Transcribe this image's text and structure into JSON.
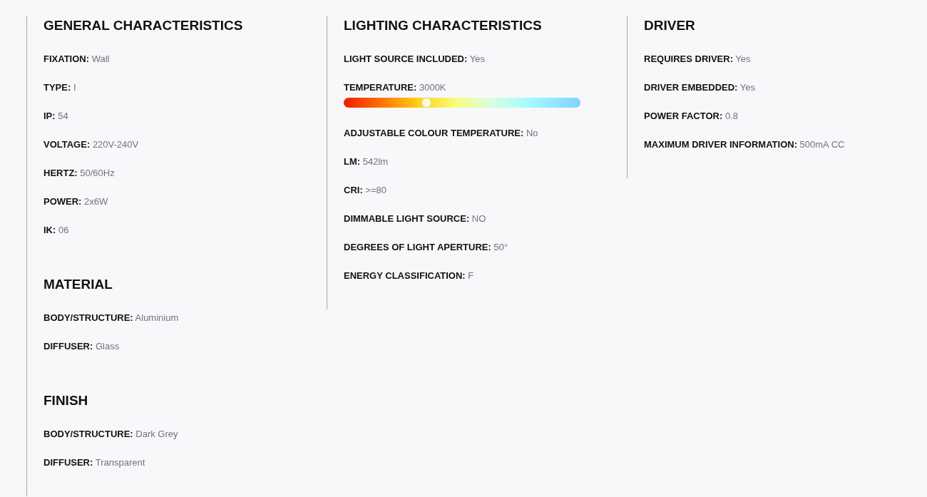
{
  "columns": [
    {
      "sections": [
        {
          "title": "GENERAL CHARACTERISTICS",
          "items": [
            {
              "kind": "text",
              "label": "FIXATION:",
              "value": "Wall"
            },
            {
              "kind": "text",
              "label": "TYPE:",
              "value": "I"
            },
            {
              "kind": "text",
              "label": "IP:",
              "value": "54"
            },
            {
              "kind": "text",
              "label": "VOLTAGE:",
              "value": "220V-240V"
            },
            {
              "kind": "text",
              "label": "HERTZ:",
              "value": "50/60Hz"
            },
            {
              "kind": "text",
              "label": "POWER:",
              "value": "2x6W"
            },
            {
              "kind": "text",
              "label": "IK:",
              "value": "06"
            }
          ]
        },
        {
          "title": "MATERIAL",
          "items": [
            {
              "kind": "text",
              "label": "BODY/STRUCTURE:",
              "value": "Aluminium"
            },
            {
              "kind": "text",
              "label": "DIFFUSER:",
              "value": "Glass"
            }
          ]
        },
        {
          "title": "FINISH",
          "items": [
            {
              "kind": "text",
              "label": "BODY/STRUCTURE:",
              "value": "Dark Grey"
            },
            {
              "kind": "text",
              "label": "DIFFUSER:",
              "value": "Transparent"
            }
          ]
        }
      ]
    },
    {
      "sections": [
        {
          "title": "LIGHTING CHARACTERISTICS",
          "items": [
            {
              "kind": "text",
              "label": "LIGHT SOURCE INCLUDED:",
              "value": "Yes"
            },
            {
              "kind": "temperature",
              "label": "TEMPERATURE:",
              "value": "3000K",
              "level": 0.35
            },
            {
              "kind": "text",
              "label": "ADJUSTABLE COLOUR TEMPERATURE:",
              "value": "No"
            },
            {
              "kind": "text",
              "label": "LM:",
              "value": "542lm"
            },
            {
              "kind": "text",
              "label": "CRI:",
              "value": ">=80"
            },
            {
              "kind": "text",
              "label": "DIMMABLE LIGHT SOURCE:",
              "value": "NO"
            },
            {
              "kind": "text",
              "label": "DEGREES OF LIGHT APERTURE:",
              "value": "50°"
            },
            {
              "kind": "text",
              "label": "ENERGY CLASSIFICATION:",
              "value": "F"
            }
          ]
        }
      ]
    },
    {
      "sections": [
        {
          "title": "DRIVER",
          "items": [
            {
              "kind": "text",
              "label": "REQUIRES DRIVER:",
              "value": "Yes"
            },
            {
              "kind": "text",
              "label": "DRIVER EMBEDDED:",
              "value": "Yes"
            },
            {
              "kind": "text",
              "label": "POWER FACTOR:",
              "value": "0.8"
            },
            {
              "kind": "text",
              "label": "MAXIMUM DRIVER INFORMATION:",
              "value": "500mA CC"
            }
          ]
        }
      ]
    }
  ]
}
